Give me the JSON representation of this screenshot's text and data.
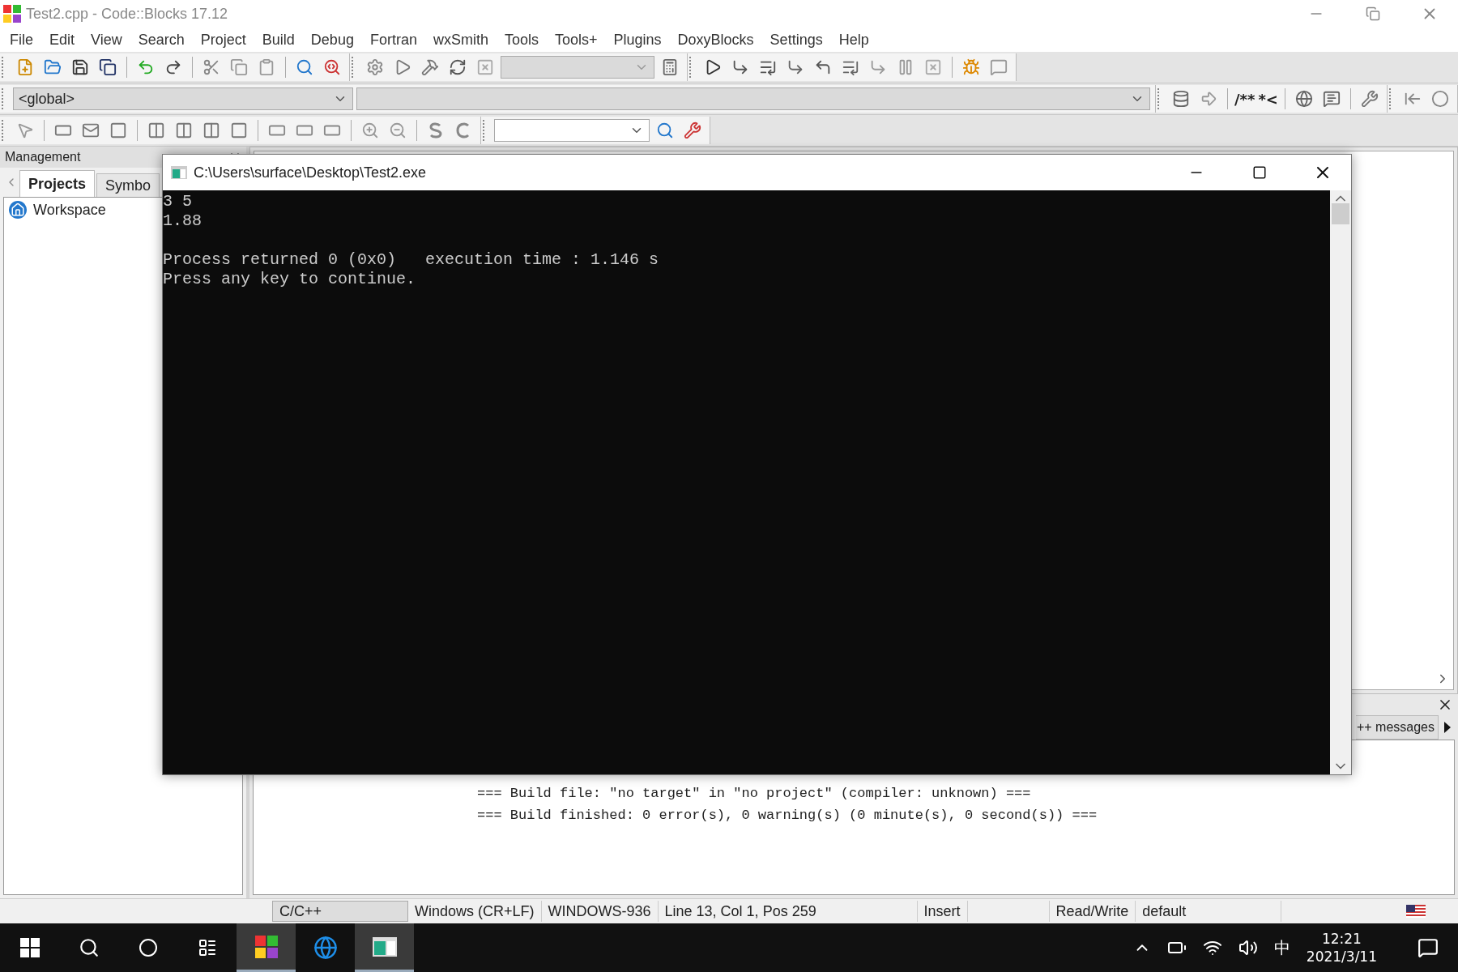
{
  "window": {
    "title": "Test2.cpp - Code::Blocks 17.12"
  },
  "menu": [
    "File",
    "Edit",
    "View",
    "Search",
    "Project",
    "Build",
    "Debug",
    "Fortran",
    "wxSmith",
    "Tools",
    "Tools+",
    "Plugins",
    "DoxyBlocks",
    "Settings",
    "Help"
  ],
  "scope": {
    "value": "<global>"
  },
  "doxy": {
    "block_comment": "/**",
    "line_comment": "*<"
  },
  "management": {
    "title": "Management",
    "tabs": [
      {
        "label": "Projects",
        "selected": true
      },
      {
        "label": "Symbo",
        "selected": false
      }
    ],
    "tree": [
      {
        "label": "Workspace"
      }
    ]
  },
  "console": {
    "title": "C:\\Users\\surface\\Desktop\\Test2.exe",
    "output": [
      "3 5",
      "1.88"
    ],
    "summary": [
      "Process returned 0 (0x0)   execution time : 1.146 s",
      "Press any key to continue."
    ]
  },
  "logs": {
    "tab": "++ messages",
    "lines": [
      "=== Build file: \"no target\" in \"no project\" (compiler: unknown) ===",
      "=== Build finished: 0 error(s), 0 warning(s) (0 minute(s), 0 second(s)) ==="
    ]
  },
  "status_bar": [
    {
      "text": "C/C++",
      "kind": "sunken"
    },
    {
      "text": "Windows (CR+LF)",
      "kind": "plain"
    },
    {
      "text": "WINDOWS-936",
      "kind": "plain"
    },
    {
      "text": "Line 13, Col 1, Pos 259",
      "kind": "wide"
    },
    {
      "text": "Insert",
      "kind": "plain"
    },
    {
      "text": "Read/Write",
      "kind": "gap"
    },
    {
      "text": "default",
      "kind": "end"
    }
  ],
  "taskbar": {
    "apps": [
      {
        "kind": "codeblocks",
        "selected": true
      },
      {
        "kind": "edge",
        "selected": false
      },
      {
        "kind": "console",
        "selected": true
      }
    ],
    "ime": "中",
    "time": "12:21",
    "date": "2021/3/11"
  }
}
